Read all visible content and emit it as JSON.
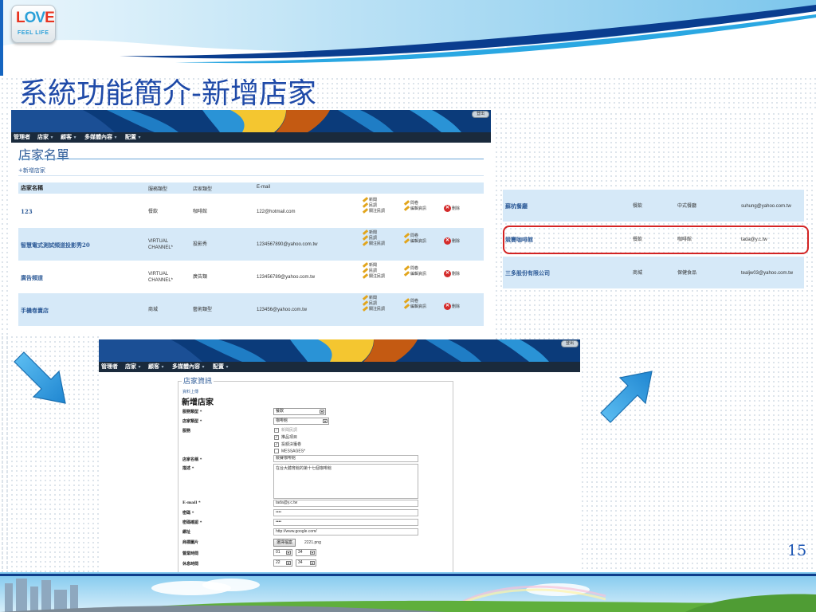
{
  "slide": {
    "title": "系統功能簡介-新增店家",
    "page_number": "15"
  },
  "logo": {
    "word": "LOVE",
    "tagline": "FEEL LIFE"
  },
  "menu": {
    "items": [
      "管理者",
      "店家",
      "顧客",
      "多媒體內容",
      "配置"
    ],
    "exit_label": "登出"
  },
  "store_list": {
    "title": "店家名單",
    "add_link": "+新增店家",
    "columns": [
      "店家名稱",
      "服務類型",
      "店家類型",
      "E-mail"
    ],
    "actions": [
      "新聞",
      "民調",
      "關注民調",
      "問卷",
      "編輯資訊",
      "刪除"
    ],
    "rows": [
      {
        "name": "123",
        "service": "餐飲",
        "type": "咖啡館",
        "email": "122@hotmail.com"
      },
      {
        "name": "智慧電式測試頻道投影秀20",
        "service": "VIRTUAL CHANNEL*",
        "type": "投影秀",
        "email": "1234567890@yahoo.com.tw"
      },
      {
        "name": "廣告頻道",
        "service": "VIRTUAL CHANNEL*",
        "type": "廣告類",
        "email": "123456789@yahoo.com.tw"
      },
      {
        "name": "手機卷賣店",
        "service": "商城",
        "type": "藝術類型",
        "email": "123456@yahoo.com.tw"
      }
    ]
  },
  "zoom_rows": [
    {
      "name": "蘇杭餐廳",
      "service": "餐飲",
      "type": "中式餐廳",
      "email": "suhung@yahoo.com.tw"
    },
    {
      "name": "競賽咖啡館",
      "service": "餐飲",
      "type": "咖啡館",
      "email": "tada@y.c.tw"
    },
    {
      "name": "三多股份有限公司",
      "service": "商城",
      "type": "保健食品",
      "email": "tealjw03@yahoo.com.tw"
    }
  ],
  "store_form": {
    "section_title": "店家資訊",
    "link": "資料上傳",
    "heading": "新增店家",
    "labels": {
      "service_type": "服務類型 *",
      "store_type": "店家類型 *",
      "services": "服務",
      "store_name": "店家名稱 *",
      "description": "描述 *",
      "email": "E-mail *",
      "password": "密碼 *",
      "password_confirm": "密碼確認 *",
      "website": "網址",
      "logo": "商標圖片",
      "open_time": "營業時間",
      "rest_time": "休息時間"
    },
    "service_type_value": "餐飲",
    "store_type_value": "咖啡館",
    "service_options": [
      {
        "label": "新聞民調",
        "checked": true
      },
      {
        "label": "推品項目",
        "checked": true
      },
      {
        "label": "投額決獲卷",
        "checked": true
      },
      {
        "label": "MESSAGES*",
        "checked": false
      }
    ],
    "store_name_value": "競賽咖啡館",
    "description_value": "在台大體育館的第十七個咖啡館",
    "email_value": "tada@y.c.tw",
    "password_value": "••••",
    "password_confirm_value": "••••",
    "website_value": "http://www.google.com/",
    "file_button": "選擇檔案",
    "file_name": "2221.png",
    "open_hour": "01",
    "open_min": "34",
    "rest_hour": "22",
    "rest_min": "34"
  },
  "colors": {
    "title_blue": "#1f4aa8",
    "row_blue": "#d6e9f8",
    "highlight_red": "#d32424",
    "arrow_blue": "#2f9be0"
  }
}
